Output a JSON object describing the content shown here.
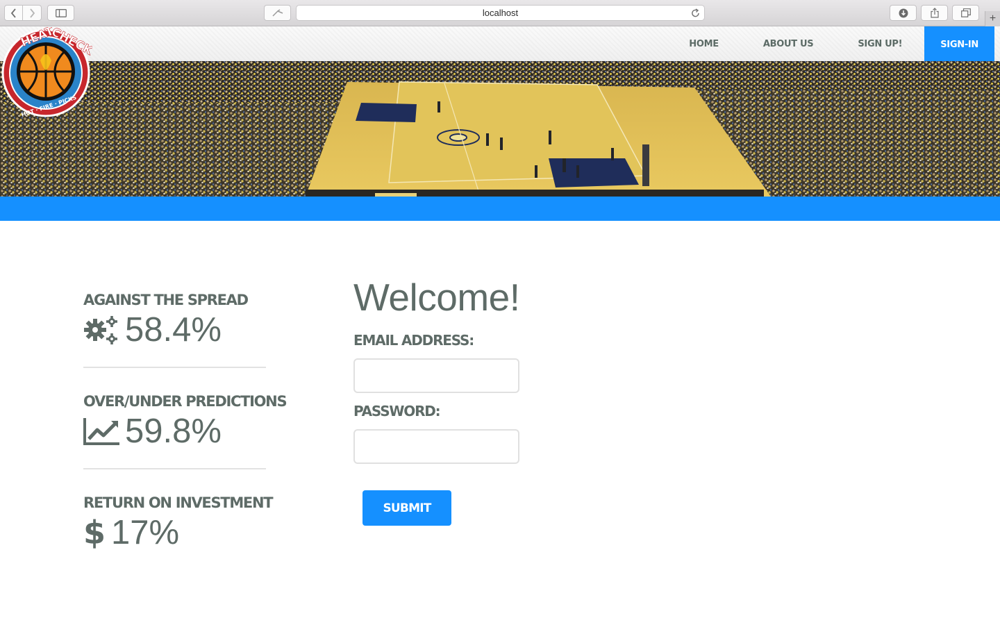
{
  "browser": {
    "url": "localhost",
    "icons": [
      "back-arrow-icon",
      "forward-arrow-icon",
      "sidebar-icon",
      "reader-icon",
      "reload-icon",
      "download-icon",
      "share-icon",
      "tabs-icon",
      "plus-icon"
    ]
  },
  "brand": {
    "logo_lines": [
      "HEAT",
      "CHECK",
      "HOT · FIRE · PICKS"
    ],
    "logo_icon": "basketball-logo"
  },
  "nav": {
    "items": [
      "HOME",
      "ABOUT US",
      "SIGN UP!",
      "SIGN-IN"
    ],
    "active": "SIGN-IN"
  },
  "stats": [
    {
      "title": "AGAINST THE SPREAD",
      "value": "58.4%",
      "icon": "gears-icon"
    },
    {
      "title": "OVER/UNDER PREDICTIONS",
      "value": "59.8%",
      "icon": "line-chart-icon"
    },
    {
      "title": "RETURN ON INVESTMENT",
      "value": "17%",
      "icon": "dollar-icon"
    }
  ],
  "form": {
    "heading": "Welcome!",
    "email_label": "EMAIL ADDRESS:",
    "email_value": "",
    "password_label": "PASSWORD:",
    "password_value": "",
    "submit_label": "SUBMIT"
  },
  "colors": {
    "accent": "#1590ff",
    "text": "#5e6b67",
    "divider": "#e2e2e2"
  }
}
